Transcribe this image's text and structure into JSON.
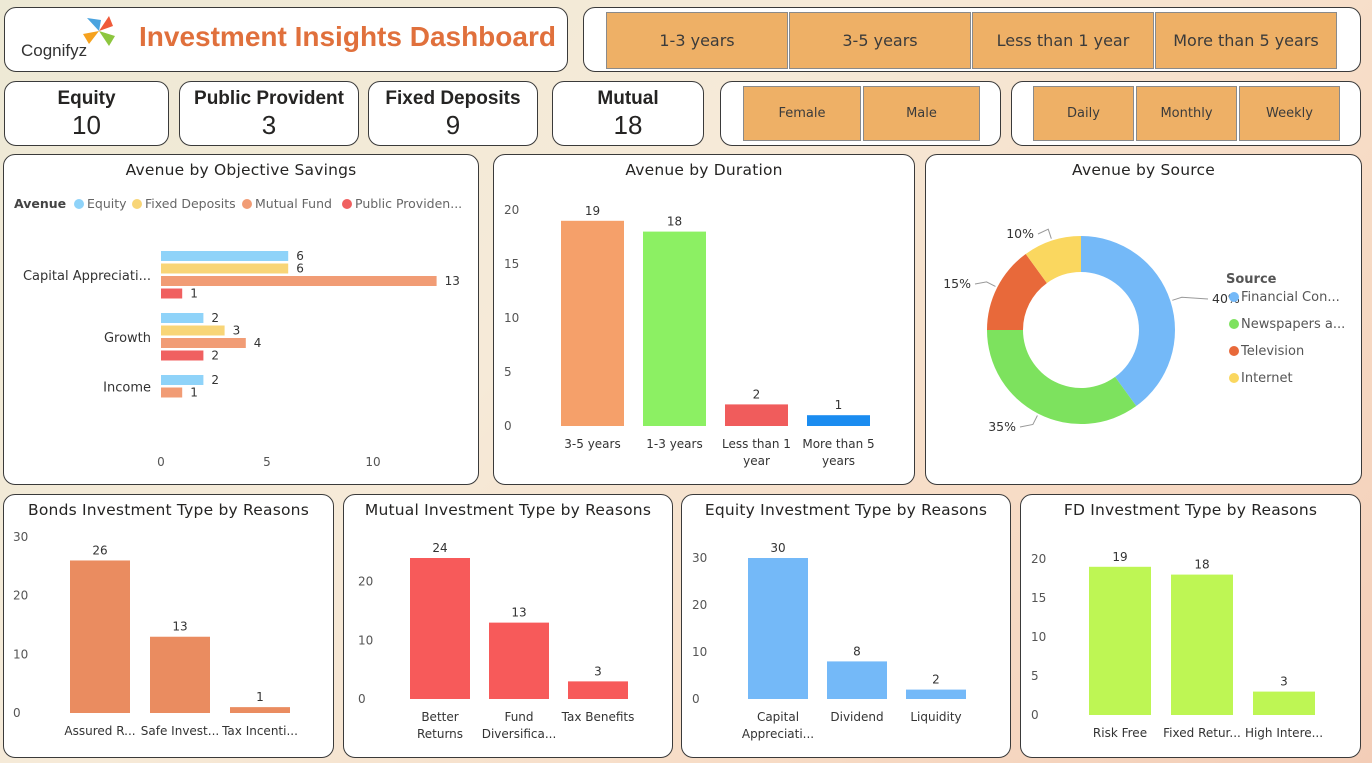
{
  "header": {
    "logo_text": "Cognifyz",
    "title": "Investment Insights Dashboard"
  },
  "colors": {
    "accent": "#e0703c",
    "slicer_fill": "#eeb066",
    "panel_border": "#3a3a3a"
  },
  "duration_slicer": [
    "1-3 years",
    "3-5 years",
    "Less than 1 year",
    "More than 5 years"
  ],
  "gender_slicer": [
    "Female",
    "Male"
  ],
  "frequency_slicer": [
    "Daily",
    "Monthly",
    "Weekly"
  ],
  "kpis": [
    {
      "label": "Equity",
      "value": "10"
    },
    {
      "label": "Public Provident",
      "value": "3"
    },
    {
      "label": "Fixed Deposits",
      "value": "9"
    },
    {
      "label": "Mutual",
      "value": "18"
    }
  ],
  "chart_data": [
    {
      "type": "bar",
      "orientation": "horizontal",
      "title": "Avenue by Objective Savings",
      "legend_title": "Avenue",
      "legend_position": "top-left",
      "categories": [
        "Capital Appreciati...",
        "Growth",
        "Income"
      ],
      "series": [
        {
          "name": "Equity",
          "color": "#8fd3f9",
          "values": [
            6,
            2,
            2
          ]
        },
        {
          "name": "Fixed Deposits",
          "color": "#f8d577",
          "values": [
            6,
            3,
            null
          ]
        },
        {
          "name": "Mutual Fund",
          "color": "#f19c75",
          "values": [
            13,
            4,
            1
          ]
        },
        {
          "name": "Public Providen...",
          "color": "#f06060",
          "values": [
            1,
            2,
            null
          ]
        }
      ],
      "xlim": [
        0,
        13
      ],
      "xticks": [
        0,
        5,
        10
      ]
    },
    {
      "type": "bar",
      "title": "Avenue by Duration",
      "categories": [
        "3-5 years",
        "1-3 years",
        "Less than 1 year",
        "More than 5 years"
      ],
      "category_lines": [
        [
          "3-5 years"
        ],
        [
          "1-3 years"
        ],
        [
          "Less than 1",
          "year"
        ],
        [
          "More than 5",
          "years"
        ]
      ],
      "values": [
        19,
        18,
        2,
        1
      ],
      "colors": [
        "#f5a06a",
        "#8cf063",
        "#f05c5c",
        "#1a8cf0"
      ],
      "ylim": [
        0,
        20
      ],
      "yticks": [
        0,
        5,
        10,
        15,
        20
      ]
    },
    {
      "type": "pie",
      "donut": true,
      "title": "Avenue by Source",
      "legend_title": "Source",
      "legend_position": "right",
      "labels": [
        "Financial Con...",
        "Newspapers a...",
        "Television",
        "Internet"
      ],
      "values": [
        40,
        35,
        15,
        10
      ],
      "value_labels": [
        "40%",
        "35%",
        "15%",
        "10%"
      ],
      "colors": [
        "#74b9f8",
        "#7de25e",
        "#e8693a",
        "#fad75f"
      ]
    },
    {
      "type": "bar",
      "title": "Bonds Investment Type by Reasons",
      "categories": [
        "Assured R...",
        "Safe Invest...",
        "Tax Incenti..."
      ],
      "category_lines": [
        [
          "Assured R..."
        ],
        [
          "Safe Invest..."
        ],
        [
          "Tax Incenti..."
        ]
      ],
      "values": [
        26,
        13,
        1
      ],
      "colors": [
        "#ea8c60",
        "#ea8c60",
        "#ea8c60"
      ],
      "ylim": [
        0,
        30
      ],
      "yticks": [
        0,
        10,
        20,
        30
      ]
    },
    {
      "type": "bar",
      "title": "Mutual Investment Type by Reasons",
      "categories": [
        "Better Returns",
        "Fund Diversifica...",
        "Tax Benefits"
      ],
      "category_lines": [
        [
          "Better",
          "Returns"
        ],
        [
          "Fund",
          "Diversifica..."
        ],
        [
          "Tax Benefits"
        ]
      ],
      "values": [
        24,
        13,
        3
      ],
      "colors": [
        "#f75a5a",
        "#f75a5a",
        "#f75a5a"
      ],
      "ylim": [
        0,
        24
      ],
      "yticks": [
        0,
        10,
        20
      ]
    },
    {
      "type": "bar",
      "title": "Equity Investment Type by Reasons",
      "categories": [
        "Capital Appreciati...",
        "Dividend",
        "Liquidity"
      ],
      "category_lines": [
        [
          "Capital",
          "Appreciati..."
        ],
        [
          "Dividend"
        ],
        [
          "Liquidity"
        ]
      ],
      "values": [
        30,
        8,
        2
      ],
      "colors": [
        "#74b9f8",
        "#74b9f8",
        "#74b9f8"
      ],
      "ylim": [
        0,
        30
      ],
      "yticks": [
        0,
        10,
        20,
        30
      ]
    },
    {
      "type": "bar",
      "title": "FD Investment Type by Reasons",
      "categories": [
        "Risk Free",
        "Fixed Retur...",
        "High Intere..."
      ],
      "category_lines": [
        [
          "Risk Free"
        ],
        [
          "Fixed Retur..."
        ],
        [
          "High Intere..."
        ]
      ],
      "values": [
        19,
        18,
        3
      ],
      "colors": [
        "#bef654",
        "#bef654",
        "#bef654"
      ],
      "ylim": [
        0,
        20
      ],
      "yticks": [
        0,
        5,
        10,
        15,
        20
      ]
    }
  ]
}
